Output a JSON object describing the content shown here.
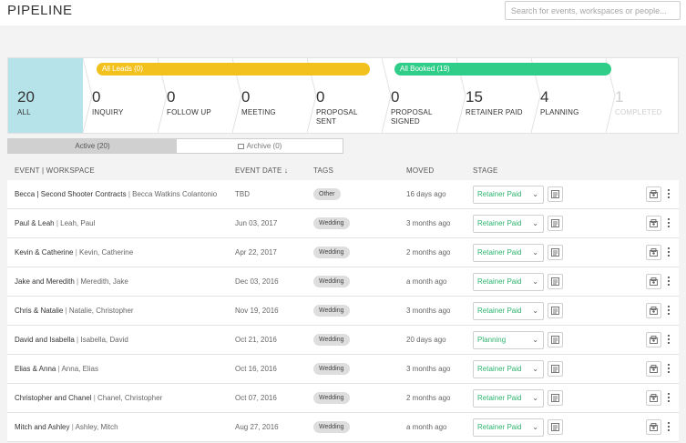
{
  "header": {
    "title": "PIPELINE",
    "search_placeholder": "Search for events, workspaces or people..."
  },
  "groups": {
    "leads": "All Leads (0)",
    "booked": "All Booked (19)"
  },
  "stages": [
    {
      "count": "20",
      "name": "ALL"
    },
    {
      "count": "0",
      "name": "INQUIRY"
    },
    {
      "count": "0",
      "name": "FOLLOW UP"
    },
    {
      "count": "0",
      "name": "MEETING"
    },
    {
      "count": "0",
      "name": "PROPOSAL SENT"
    },
    {
      "count": "0",
      "name": "PROPOSAL SIGNED"
    },
    {
      "count": "15",
      "name": "RETAINER PAID"
    },
    {
      "count": "4",
      "name": "PLANNING"
    },
    {
      "count": "1",
      "name": "COMPLETED"
    }
  ],
  "tabs": {
    "active": "Active (20)",
    "archive": "Archive (0)"
  },
  "columns": {
    "event": "EVENT | WORKSPACE",
    "date": "EVENT DATE ↓",
    "tags": "TAGS",
    "moved": "MOVED",
    "stage": "STAGE"
  },
  "colors": {
    "leads": "#f2c11d",
    "booked": "#2fcd87",
    "active_stage": "#b6e3ea",
    "stage_text": "#2eb36f"
  },
  "rows": [
    {
      "event": "Becca | Second Shooter Contracts",
      "people": "Becca Watkins Colantonio",
      "date": "TBD",
      "tag": "Other",
      "moved": "16 days ago",
      "stage": "Retainer Paid"
    },
    {
      "event": "Paul & Leah",
      "people": "Leah, Paul",
      "date": "Jun 03, 2017",
      "tag": "Wedding",
      "moved": "3 months ago",
      "stage": "Retainer Paid"
    },
    {
      "event": "Kevin & Catherine",
      "people": "Kevin, Catherine",
      "date": "Apr 22, 2017",
      "tag": "Wedding",
      "moved": "2 months ago",
      "stage": "Retainer Paid"
    },
    {
      "event": "Jake and Meredith",
      "people": "Meredith, Jake",
      "date": "Dec 03, 2016",
      "tag": "Wedding",
      "moved": "a month ago",
      "stage": "Retainer Paid"
    },
    {
      "event": "Chris & Natalie",
      "people": "Natalie, Christopher",
      "date": "Nov 19, 2016",
      "tag": "Wedding",
      "moved": "3 months ago",
      "stage": "Retainer Paid"
    },
    {
      "event": "David and Isabella",
      "people": "Isabella, David",
      "date": "Oct 21, 2016",
      "tag": "Wedding",
      "moved": "20 days ago",
      "stage": "Planning"
    },
    {
      "event": "Elias & Anna",
      "people": "Anna, Elias",
      "date": "Oct 16, 2016",
      "tag": "Wedding",
      "moved": "3 months ago",
      "stage": "Retainer Paid"
    },
    {
      "event": "Christopher and Chanel",
      "people": "Chanel, Christopher",
      "date": "Oct 07, 2016",
      "tag": "Wedding",
      "moved": "2 months ago",
      "stage": "Retainer Paid"
    },
    {
      "event": "Mitch and Ashley",
      "people": "Ashley, Mitch",
      "date": "Aug 27, 2016",
      "tag": "Wedding",
      "moved": "a month ago",
      "stage": "Retainer Paid"
    }
  ]
}
